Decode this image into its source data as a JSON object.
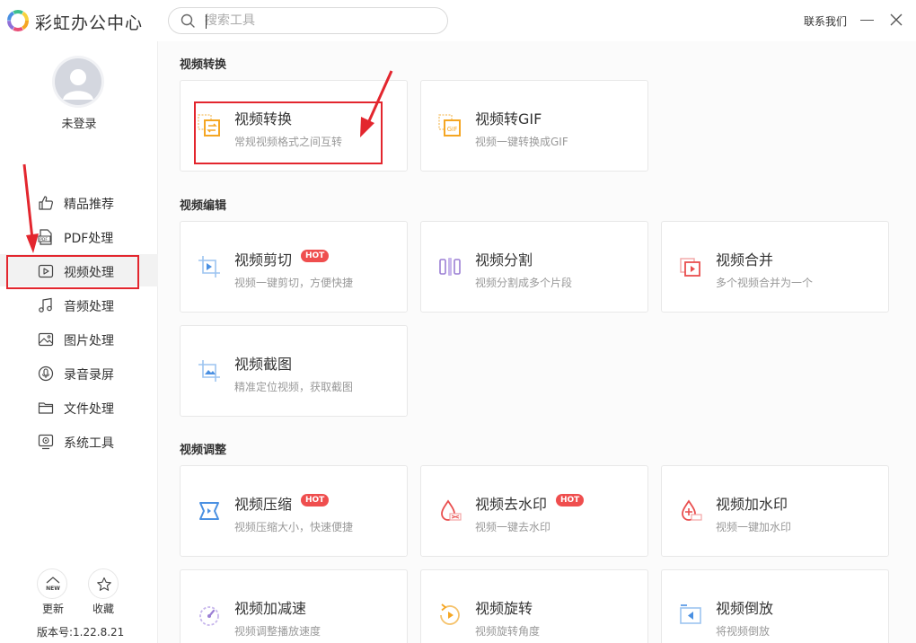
{
  "app": {
    "title": "彩虹办公中心"
  },
  "search": {
    "placeholder": "搜索工具"
  },
  "header": {
    "contact_label": "联系我们"
  },
  "user": {
    "status": "未登录"
  },
  "sidebar": {
    "items": [
      {
        "label": "精品推荐",
        "icon": "thumbs-up-icon"
      },
      {
        "label": "PDF处理",
        "icon": "pdf-icon"
      },
      {
        "label": "视频处理",
        "icon": "video-icon",
        "active": true
      },
      {
        "label": "音频处理",
        "icon": "music-icon"
      },
      {
        "label": "图片处理",
        "icon": "image-icon"
      },
      {
        "label": "录音录屏",
        "icon": "record-icon"
      },
      {
        "label": "文件处理",
        "icon": "folder-icon"
      },
      {
        "label": "系统工具",
        "icon": "system-icon"
      }
    ],
    "update_label": "更新",
    "update_badge": "NEW",
    "favorite_label": "收藏",
    "version": "版本号:1.22.8.21"
  },
  "sections": [
    {
      "title": "视频转换",
      "cards": [
        {
          "title": "视频转换",
          "desc": "常规视频格式之间互转",
          "icon": "video-convert-icon"
        },
        {
          "title": "视频转GIF",
          "desc": "视频一键转换成GIF",
          "icon": "gif-convert-icon"
        }
      ]
    },
    {
      "title": "视频编辑",
      "cards": [
        {
          "title": "视频剪切",
          "desc": "视频一键剪切，方便快捷",
          "hot": "HOT",
          "icon": "video-cut-icon"
        },
        {
          "title": "视频分割",
          "desc": "视频分割成多个片段",
          "icon": "video-split-icon"
        },
        {
          "title": "视频合并",
          "desc": "多个视频合并为一个",
          "icon": "video-merge-icon"
        },
        {
          "title": "视频截图",
          "desc": "精准定位视频，获取截图",
          "icon": "video-screenshot-icon"
        }
      ]
    },
    {
      "title": "视频调整",
      "cards": [
        {
          "title": "视频压缩",
          "desc": "视频压缩大小，快速便捷",
          "hot": "HOT",
          "icon": "video-compress-icon"
        },
        {
          "title": "视频去水印",
          "desc": "视频一键去水印",
          "hot": "HOT",
          "icon": "remove-watermark-icon"
        },
        {
          "title": "视频加水印",
          "desc": "视频一键加水印",
          "icon": "add-watermark-icon"
        },
        {
          "title": "视频加减速",
          "desc": "视频调整播放速度",
          "icon": "speed-icon"
        },
        {
          "title": "视频旋转",
          "desc": "视频旋转角度",
          "icon": "rotate-icon"
        },
        {
          "title": "视频倒放",
          "desc": "将视频倒放",
          "icon": "reverse-icon"
        }
      ]
    }
  ],
  "colors": {
    "accent": "#e3262e",
    "hot": "#ef4e4e",
    "orange": "#f5a623",
    "blue": "#4a90e2",
    "purple": "#9b7fd4"
  }
}
